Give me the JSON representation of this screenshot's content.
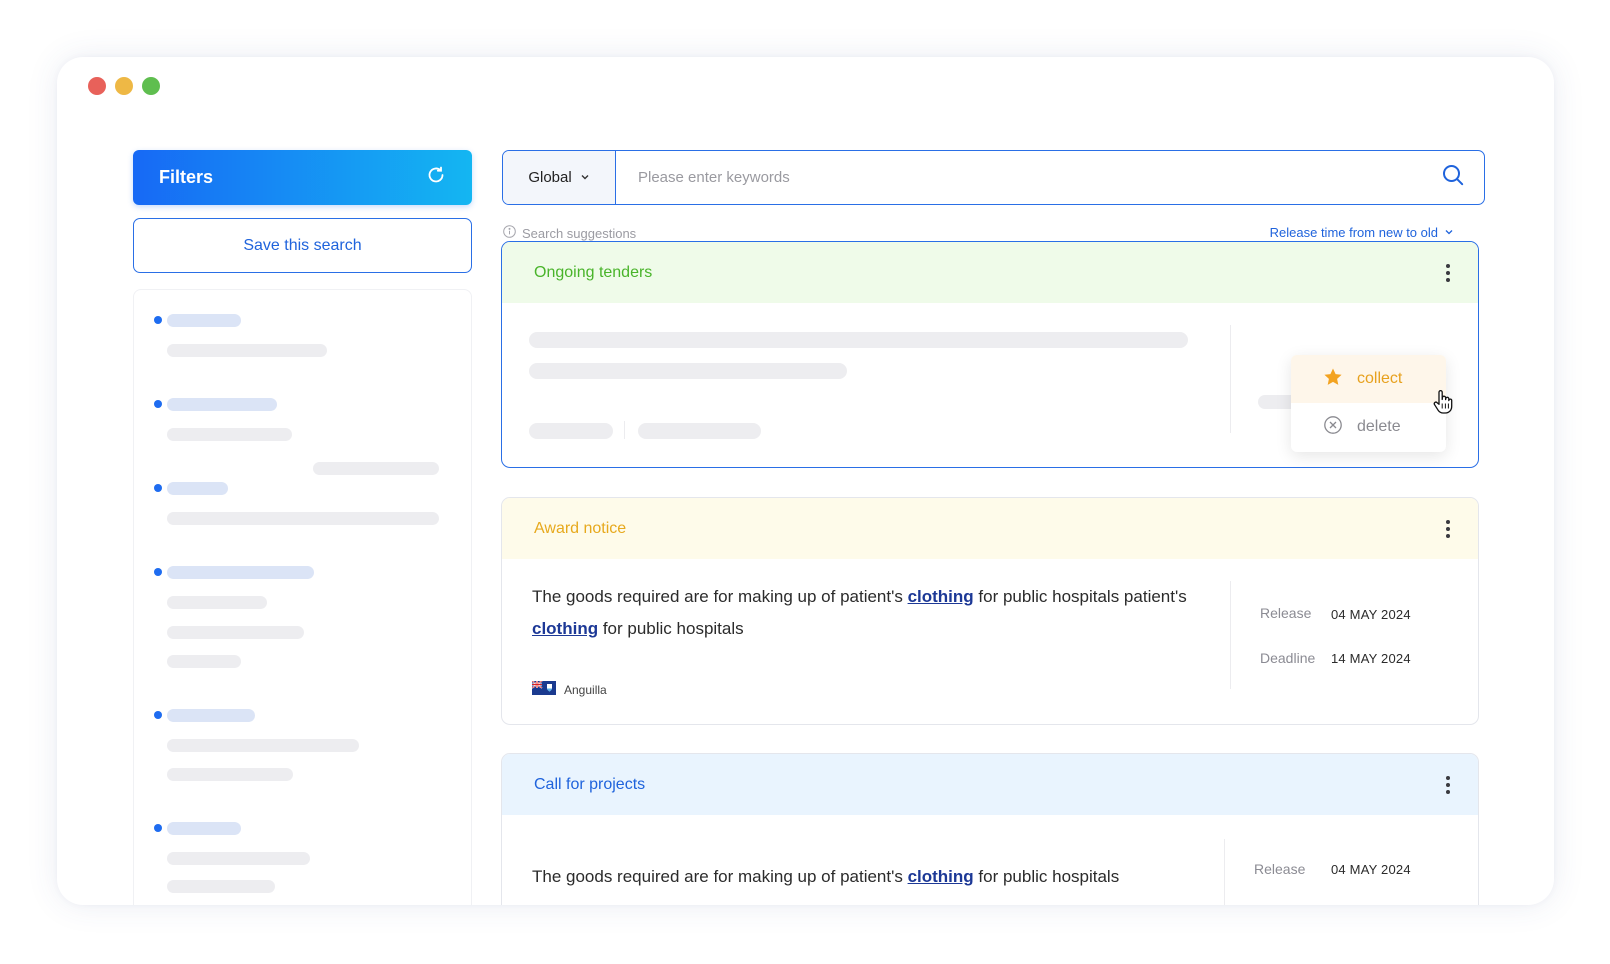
{
  "window": {
    "controls": [
      "close",
      "minimize",
      "maximize"
    ]
  },
  "sidebar": {
    "filters_label": "Filters",
    "refresh_icon": "refresh-icon",
    "save_search_label": "Save this search"
  },
  "search": {
    "scope": "Global",
    "placeholder": "Please enter keywords",
    "value": "",
    "suggestions_label": "Search suggestions",
    "sort_label": "Release time from new to old"
  },
  "cards": [
    {
      "type_label": "Ongoing tenders",
      "state": "loading"
    },
    {
      "type_label": "Award notice",
      "desc_parts": [
        "The goods required are for making up of patient's ",
        "clothing",
        " for public hospitals patient's ",
        "clothing",
        " for public hospitals"
      ],
      "country": "Anguilla",
      "release_label": "Release",
      "release_date": "04 MAY 2024",
      "deadline_label": "Deadline",
      "deadline_date": "14 MAY 2024"
    },
    {
      "type_label": "Call for projects",
      "desc_parts": [
        "The goods required are for making up of patient's ",
        "clothing",
        " for public hospitals"
      ],
      "release_label": "Release",
      "release_date": "04 MAY 2024"
    }
  ],
  "context_menu": {
    "collect_label": "collect",
    "delete_label": "delete"
  },
  "colors": {
    "accent": "#1f63dc",
    "tender_green": "#49b42a",
    "award_yellow": "#e7a91d",
    "keyword_blue": "#1c3896"
  }
}
